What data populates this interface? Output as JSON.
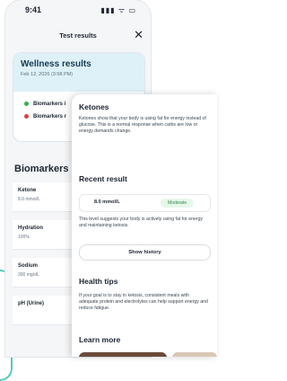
{
  "status": {
    "time": "9:41",
    "icons": "▮▮▮ ᯤ ▭"
  },
  "nav": {
    "title": "Test results",
    "close_icon": "✕"
  },
  "wellness": {
    "title": "Wellness results",
    "date": "Feb 12, 2026 (3:58 PM)",
    "lines": [
      {
        "label": "Biomarkers i",
        "color": "#2db34a"
      },
      {
        "label": "Biomarkers r",
        "color": "#e0413c"
      }
    ]
  },
  "biomarkers": {
    "title": "Biomarkers",
    "items": [
      {
        "name": "Ketone",
        "value": "8.0 mmol/L"
      },
      {
        "name": "Hydration",
        "value": "100%"
      },
      {
        "name": "Sodium",
        "value": "300 mg/dL"
      },
      {
        "name": "pH (Urine)",
        "value": ""
      }
    ]
  },
  "detail": {
    "title": "Ketones",
    "description": "Ketones show that your body is using fat for energy instead of glucose. This is a normal response when carbs are low or energy demands change.",
    "recent_title": "Recent result",
    "result_value": "8.0 mmol/L",
    "result_badge": "Moderate",
    "result_text": "This level suggests your body is actively using fat for energy and maintaining ketosis.",
    "history_button": "Show history",
    "tips_title": "Health tips",
    "tips_text": "If your goal is to stay in ketosis, consistent meals with adequate protein and electrolytes can help support energy and reduce fatigue.",
    "learn_title": "Learn more"
  },
  "colors": {
    "accent": "#53cbbc",
    "wellness_bg": "#dff1f8"
  }
}
